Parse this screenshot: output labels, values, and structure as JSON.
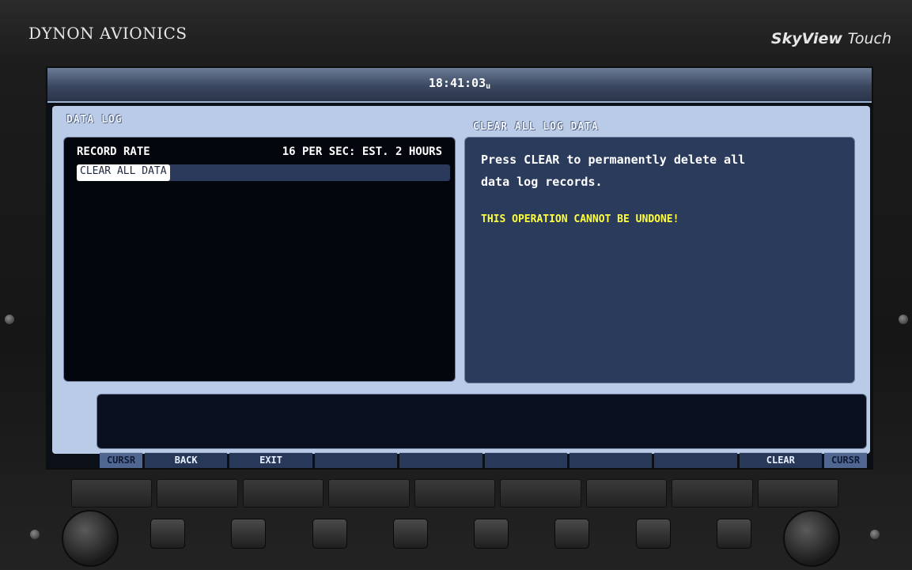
{
  "device": {
    "brand_left": "DYNON AVIONICS",
    "brand_right_bold": "SkyView",
    "brand_right_normal": "Touch"
  },
  "topbar": {
    "time": "18:41:03",
    "time_suffix": "u"
  },
  "left_panel": {
    "title": "DATA LOG",
    "rows": [
      {
        "label": "RECORD RATE",
        "value": "16 PER SEC: EST. 2 HOURS"
      }
    ],
    "selected_item": "CLEAR ALL DATA"
  },
  "right_panel": {
    "title": "CLEAR ALL LOG DATA",
    "line1": "Press CLEAR to permanently delete all",
    "line2": "data log records.",
    "warning": "THIS OPERATION CANNOT BE UNDONE!"
  },
  "softkeys": {
    "k1": "CURSR",
    "k2": "BACK",
    "k3": "EXIT",
    "k4": "",
    "k5": "",
    "k6": "",
    "k7": "",
    "k8": "",
    "k9": "CLEAR",
    "k10": "CURSR"
  },
  "colors": {
    "warning": "#ffff3d",
    "panel_blue": "#2a3b5c",
    "frame": "#b9cbe6"
  }
}
